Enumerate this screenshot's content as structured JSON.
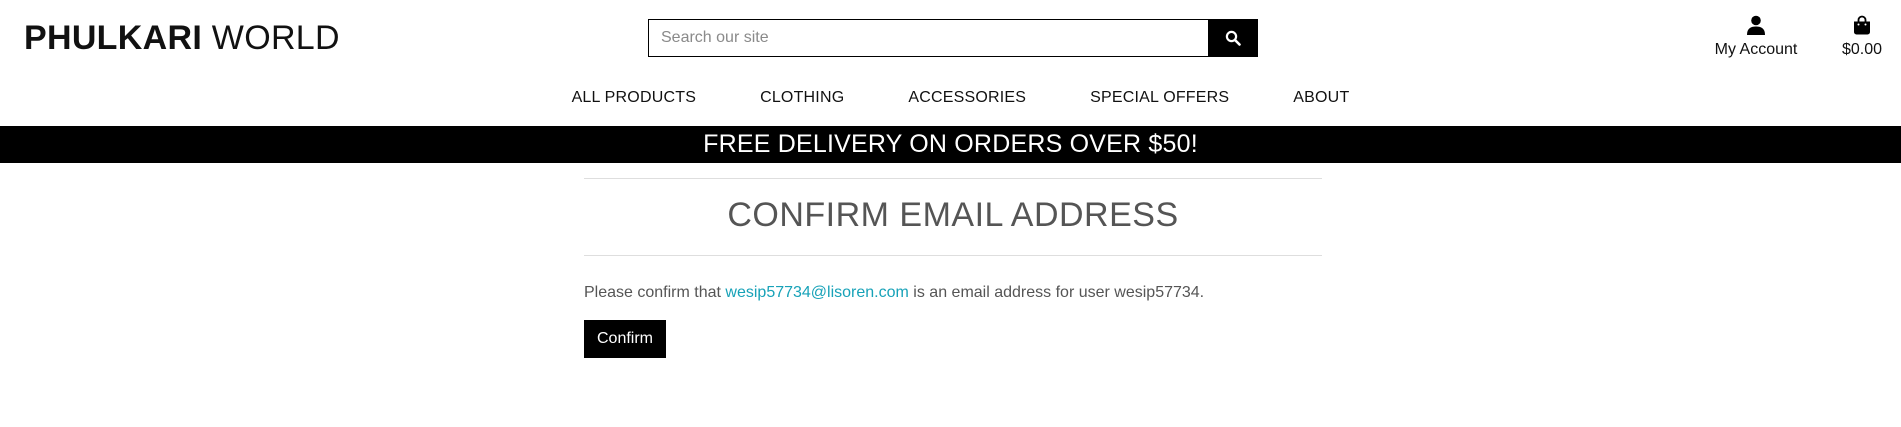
{
  "header": {
    "logo_bold": "PHULKARI",
    "logo_light": " WORLD",
    "search_placeholder": "Search our site",
    "account_label": "My Account",
    "bag_total": "$0.00"
  },
  "nav": {
    "items": [
      "ALL PRODUCTS",
      "CLOTHING",
      "ACCESSORIES",
      "SPECIAL OFFERS",
      "ABOUT"
    ]
  },
  "banner": {
    "text": "FREE DELIVERY ON ORDERS OVER $50!"
  },
  "main": {
    "title": "CONFIRM EMAIL ADDRESS",
    "message_prefix": "Please confirm that ",
    "email": "wesip57734@lisoren.com",
    "message_suffix": " is an email address for user wesip57734.",
    "confirm_label": "Confirm"
  },
  "colors": {
    "link": "#17a2b8",
    "banner_bg": "#000000"
  },
  "icons": [
    "search-icon",
    "user-icon",
    "shopping-bag-icon"
  ]
}
